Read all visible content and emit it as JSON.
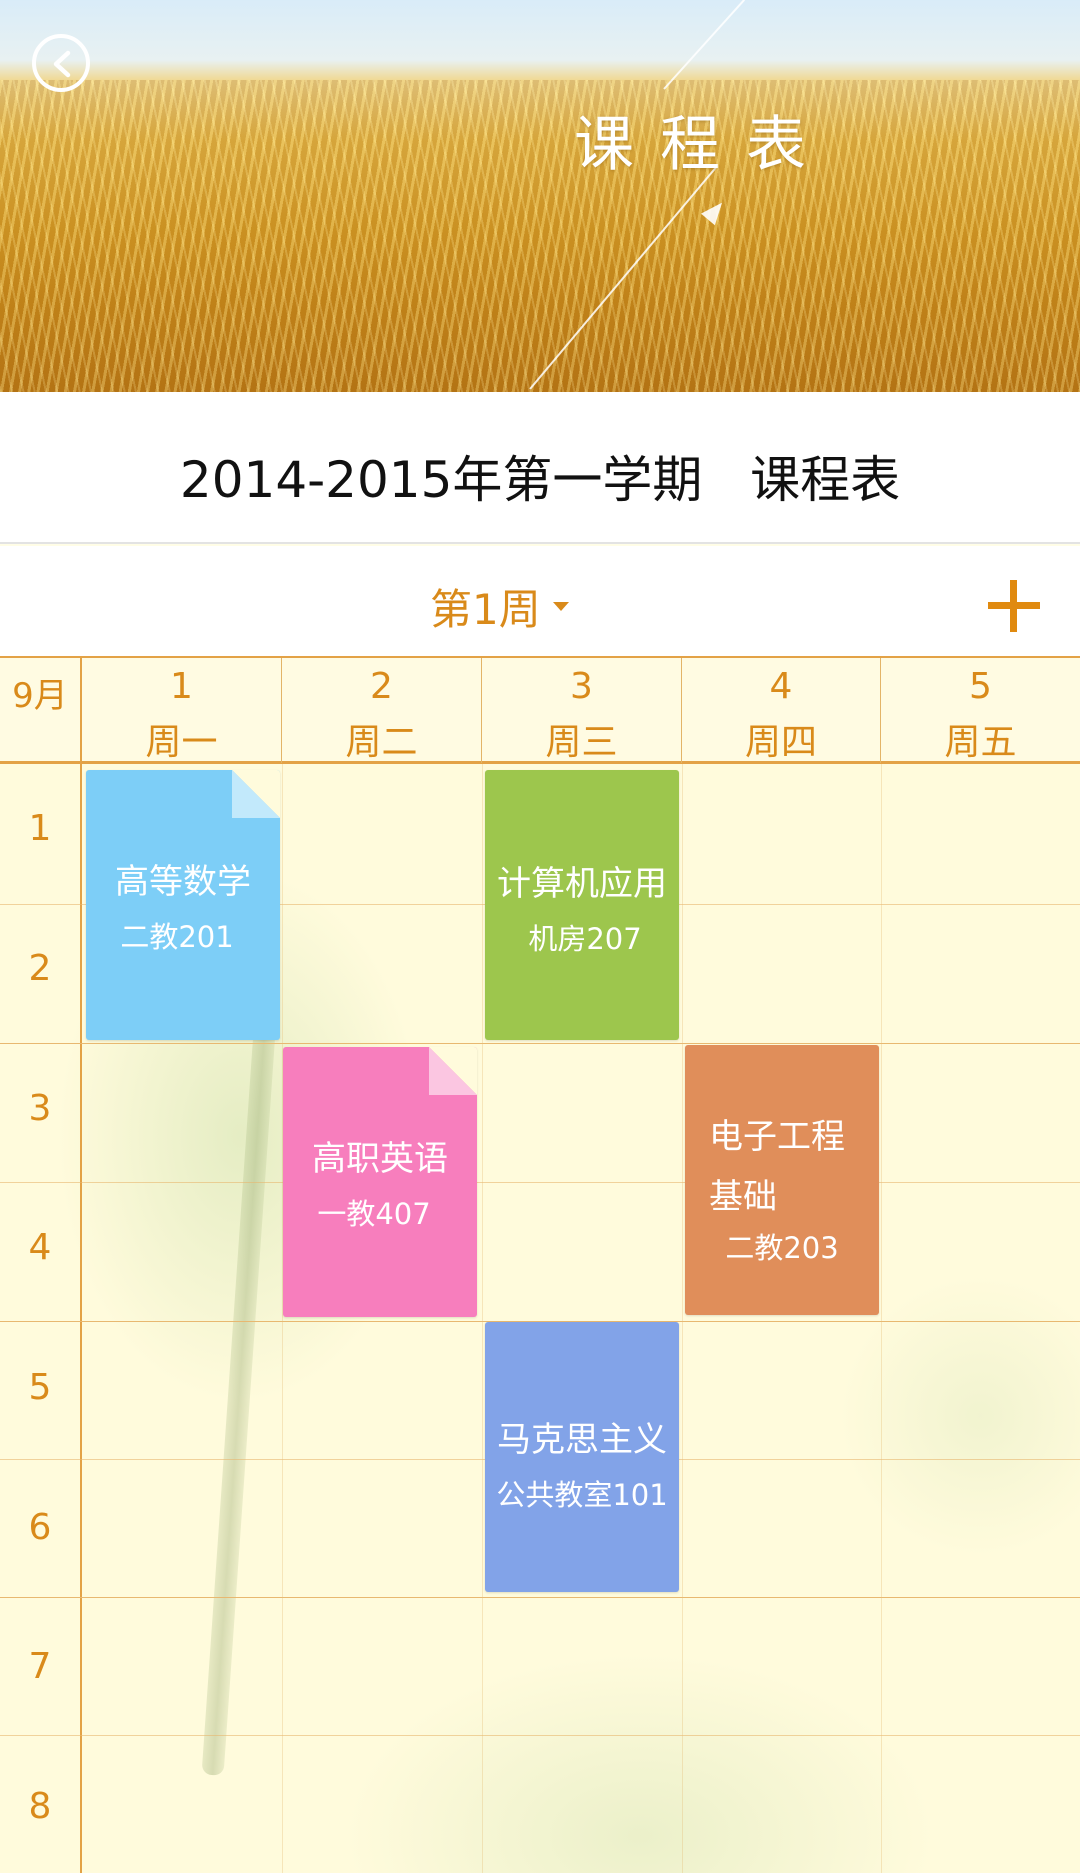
{
  "header": {
    "title": "课程表",
    "back_icon": "chevron-left-icon"
  },
  "term": {
    "title": "2014-2015年第一学期   课程表"
  },
  "week_selector": {
    "label": "第1周",
    "caret_icon": "caret-down-icon",
    "add_icon": "plus-icon"
  },
  "timetable": {
    "month": "9月",
    "days": [
      {
        "num": "1",
        "name": "周一"
      },
      {
        "num": "2",
        "name": "周二"
      },
      {
        "num": "3",
        "name": "周三"
      },
      {
        "num": "4",
        "name": "周四"
      },
      {
        "num": "5",
        "name": "周五"
      }
    ],
    "periods": [
      "1",
      "2",
      "3",
      "4",
      "5",
      "6",
      "7",
      "8"
    ]
  },
  "courses": [
    {
      "name": "高等数学",
      "room": "二教201",
      "day": 1,
      "start": 1,
      "end": 2,
      "color": "#7dcef7",
      "fold_color": "#c2e9fb"
    },
    {
      "name": "计算机应用",
      "room": "机房207",
      "day": 3,
      "start": 1,
      "end": 2,
      "color": "#9dc64d",
      "fold_color": ""
    },
    {
      "name": "高职英语",
      "room": "一教407",
      "day": 2,
      "start": 3,
      "end": 4,
      "color": "#f77ebd",
      "fold_color": "#fbc6e1"
    },
    {
      "name": "电子工程基础",
      "name_line1": "电子工程",
      "name_line2": "基础",
      "room": "二教203",
      "day": 4,
      "start": 3,
      "end": 4,
      "color": "#e08e5a",
      "fold_color": ""
    },
    {
      "name": "马克思主义",
      "room": "公共教室101",
      "day": 3,
      "start": 5,
      "end": 6,
      "color": "#82a3e8",
      "fold_color": ""
    }
  ],
  "colors": {
    "accent": "#d98a1a",
    "grid_line": "#e3a246",
    "background": "#fffbdc"
  }
}
